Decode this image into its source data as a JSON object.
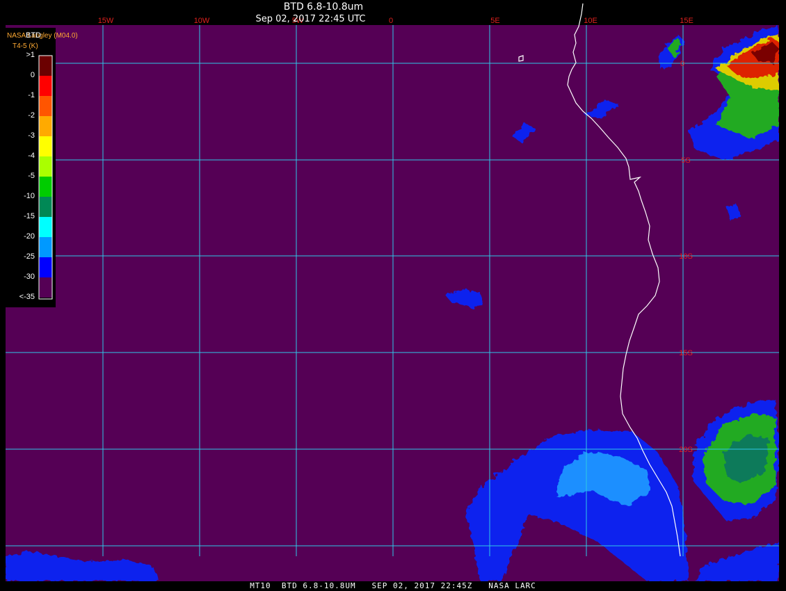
{
  "header": {
    "title": "BTD 6.8-10.8um",
    "datetime": "Sep 02, 2017 22:45 UTC",
    "producer": "NASA Langley (M04.0)"
  },
  "footer": {
    "text": "MT10  BTD 6.8-10.8UM   SEP 02, 2017 22:45Z   NASA LARC"
  },
  "legend": {
    "title": "BTD",
    "units": "T4-5 (K)",
    "labels": [
      ">1",
      "0",
      "-1",
      "-2",
      "-3",
      "-4",
      "-5",
      "-10",
      "-15",
      "-20",
      "-25",
      "-30",
      "<-35"
    ],
    "colors": [
      "#6b0000",
      "#ff0000",
      "#ff5500",
      "#ffaa00",
      "#ffff00",
      "#aaff00",
      "#00cc00",
      "#008855",
      "#00ffff",
      "#0099ff",
      "#0000ff",
      "#550055"
    ]
  },
  "map": {
    "background_color": "#550055",
    "grid_color": "#2ec8e6",
    "label_color": "#e0201e",
    "coast_color": "#ffffff",
    "longitude_labels": [
      "15W",
      "10W",
      "5W",
      "0",
      "5E",
      "10E",
      "15E"
    ],
    "latitude_labels": [
      "0",
      "5S",
      "10S",
      "15S",
      "20S"
    ]
  }
}
